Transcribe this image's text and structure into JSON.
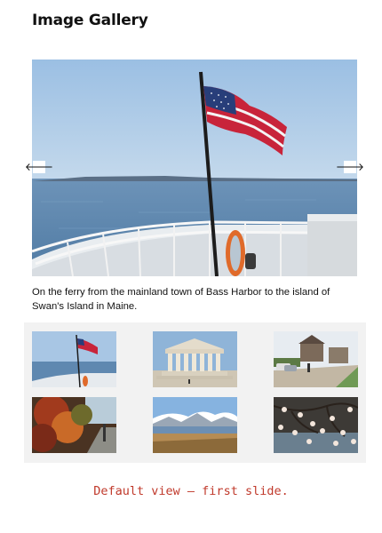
{
  "page": {
    "title": "Image Gallery",
    "caption": "On the ferry from the mainland town of Bass Harbor to the island of Swan's Island in Maine.",
    "note": "Default view – first slide."
  },
  "controls": {
    "prev_icon": "arrow-left-icon",
    "next_icon": "arrow-right-icon",
    "prev_glyph": "🡐",
    "next_glyph": "🡒"
  },
  "thumbnails": [
    {
      "subject": "ferry-flag"
    },
    {
      "subject": "courthouse"
    },
    {
      "subject": "village-street"
    },
    {
      "subject": "autumn-foliage"
    },
    {
      "subject": "mountain-lake"
    },
    {
      "subject": "cherry-blossom"
    }
  ],
  "colors": {
    "note": "#c0392b",
    "panel_bg": "#f2f2f2"
  }
}
